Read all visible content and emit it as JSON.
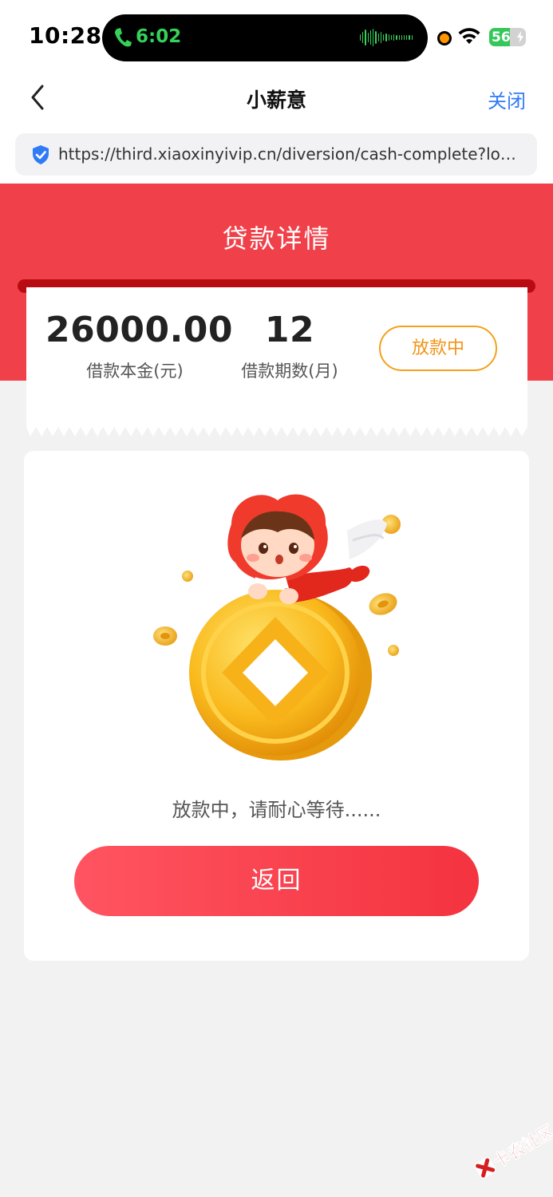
{
  "status_bar": {
    "time": "10:28",
    "call_duration": "6:02",
    "battery": "56",
    "battery_level": 0.56
  },
  "nav": {
    "title": "小薪意",
    "close_label": "关闭",
    "url": "https://third.xiaoxinyivip.cn/diversion/cash-complete?loan..."
  },
  "header": {
    "title": "贷款详情"
  },
  "loan": {
    "principal_value": "26000.00",
    "principal_label": "借款本金(元)",
    "term_value": "12",
    "term_label": "借款期数(月)",
    "status": "放款中"
  },
  "main": {
    "wait_message": "放款中，请耐心等待......",
    "return_label": "返回"
  },
  "watermark": {
    "text": "卡农社区"
  },
  "colors": {
    "header_red": "#f0414a",
    "slot_dark_red": "#b80c12",
    "badge_orange": "#f29417",
    "link_blue": "#2f7bf6",
    "button_red": "#f4333f",
    "page_bg": "#f2f2f2"
  },
  "icons": {
    "back": "chevron-left-icon",
    "shield": "shield-check-icon",
    "call": "phone-icon",
    "wifi": "wifi-icon",
    "battery": "battery-icon"
  }
}
